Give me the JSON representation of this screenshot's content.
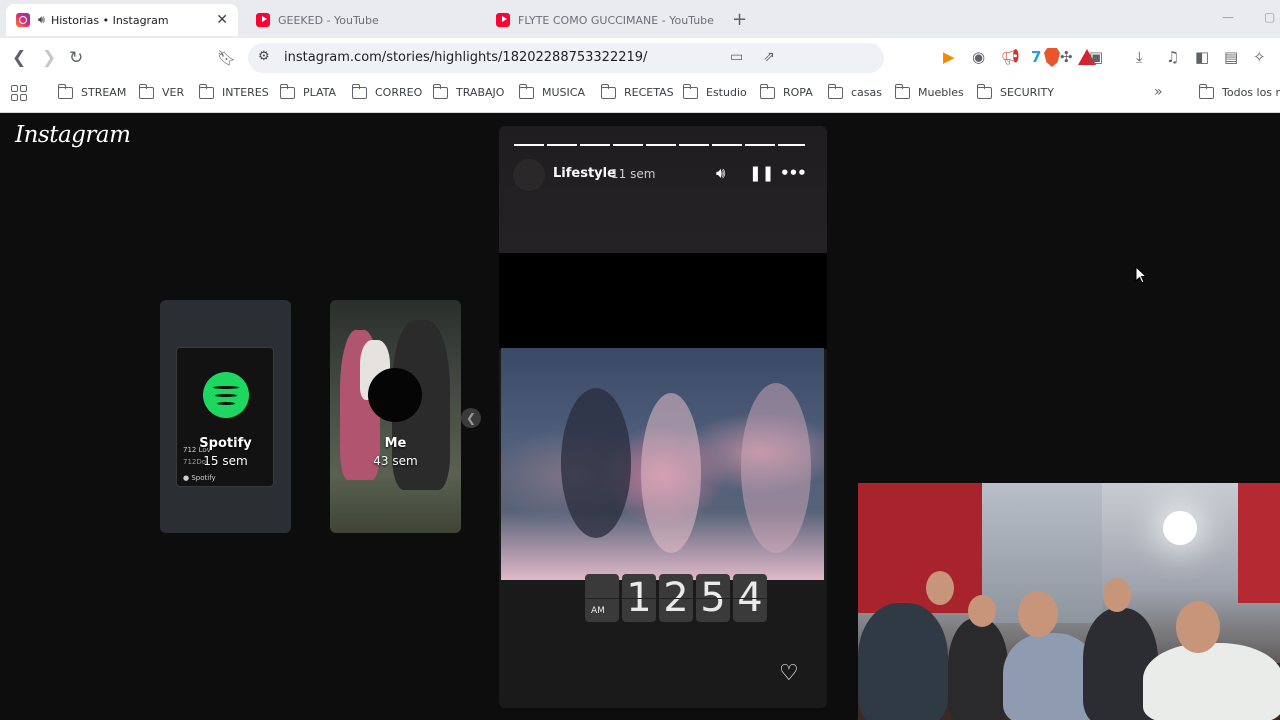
{
  "tabs": [
    {
      "label": "Historias • Instagram",
      "active": true,
      "icon": "instagram-icon",
      "audio": true
    },
    {
      "label": "GEEKED - YouTube",
      "active": false,
      "icon": "youtube-icon"
    },
    {
      "label": "FLYTE COMO GUCCIMANE - YouTube",
      "active": false,
      "icon": "youtube-icon"
    }
  ],
  "address_bar": {
    "url": "instagram.com/stories/highlights/18202288753322219/"
  },
  "bookmarks": [
    "STREAM",
    "VER",
    "INTERES",
    "PLATA",
    "CORREO",
    "TRABAJO",
    "MUSICA",
    "RECETAS",
    "Estudio",
    "ROPA",
    "casas",
    "Muebles",
    "SECURITY"
  ],
  "bookmarks_overflow": "Todos los m",
  "instagram": {
    "logo": "Instagram",
    "highlights": [
      {
        "name": "Spotify",
        "age": "15 sem",
        "card_text_1": "712 Lov",
        "card_text_2": "712Do"
      },
      {
        "name": "Me",
        "age": "43 sem"
      }
    ],
    "story": {
      "title": "Lifestyle",
      "age": "11 sem",
      "segments_total": 9,
      "clock": {
        "ampm": "AM",
        "digits": [
          "1",
          "2",
          "5",
          "4"
        ]
      }
    }
  },
  "colors": {
    "spotify_green": "#1ed760",
    "background": "#0d0d0d",
    "brave_orange": "#e8562d"
  }
}
